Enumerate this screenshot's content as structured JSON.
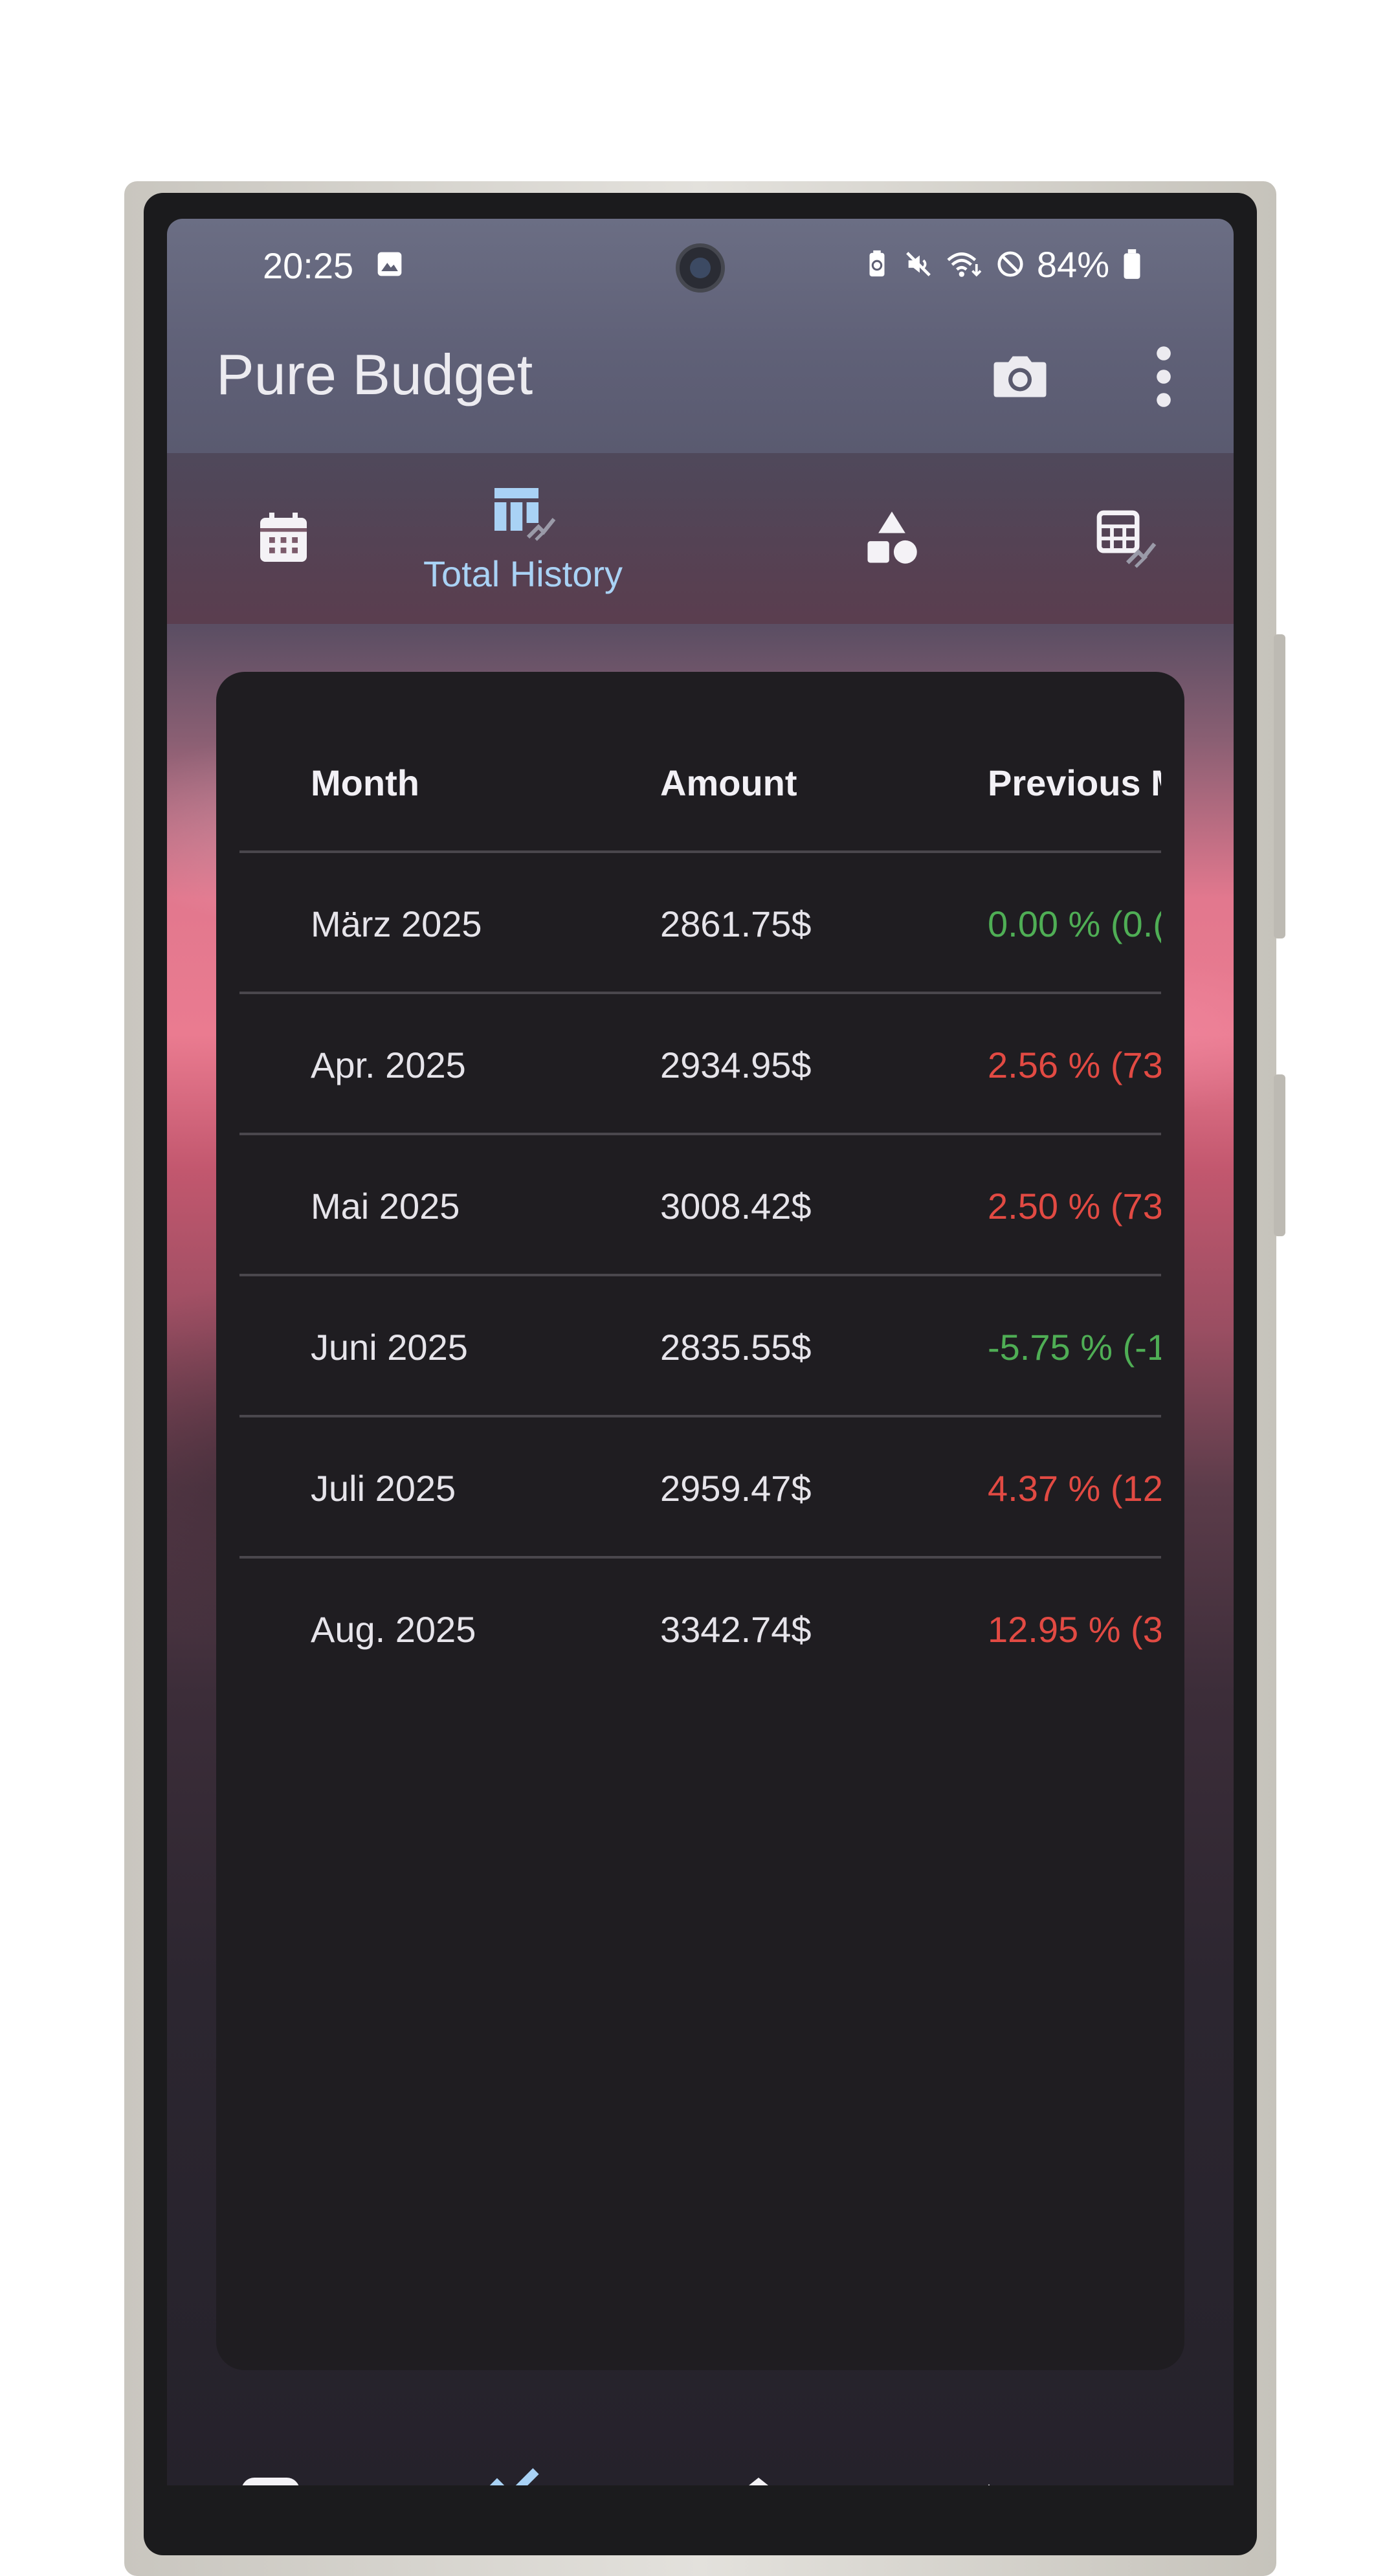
{
  "status_bar": {
    "time": "20:25",
    "battery_percent": "84%",
    "icons": [
      "image-icon",
      "battery-saver-icon",
      "mute-icon",
      "wifi-icon",
      "do-not-disturb-icon",
      "battery-icon"
    ]
  },
  "app_bar": {
    "title": "Pure Budget",
    "actions": [
      "camera-icon",
      "more-vert-icon"
    ]
  },
  "tabs": {
    "selected": "Total History",
    "items": [
      {
        "icon": "calendar-icon",
        "label": ""
      },
      {
        "icon": "table-chart-icon",
        "label": "Total History"
      },
      {
        "icon": "shapes-icon",
        "label": ""
      },
      {
        "icon": "table-chart-alt-icon",
        "label": ""
      }
    ]
  },
  "table": {
    "headers": {
      "month": "Month",
      "amount": "Amount",
      "previous": "Previous M"
    },
    "rows": [
      {
        "month": "März 2025",
        "amount": "2861.75$",
        "previous": "0.00 % (0.(",
        "trend": "positive"
      },
      {
        "month": "Apr. 2025",
        "amount": "2934.95$",
        "previous": "2.56 % (73",
        "trend": "negative"
      },
      {
        "month": "Mai 2025",
        "amount": "3008.42$",
        "previous": "2.50 % (73",
        "trend": "negative"
      },
      {
        "month": "Juni 2025",
        "amount": "2835.55$",
        "previous": "-5.75 % (-1",
        "trend": "positive"
      },
      {
        "month": "Juli 2025",
        "amount": "2959.47$",
        "previous": "4.37 % (12",
        "trend": "negative"
      },
      {
        "month": "Aug. 2025",
        "amount": "3342.74$",
        "previous": "12.95 % (3",
        "trend": "negative"
      }
    ]
  },
  "colors": {
    "positive": "#4fae55",
    "negative": "#e24a43",
    "accent": "#a9d2f5",
    "card": "#1f1d21"
  },
  "bottom_nav": {
    "items": [
      "receipt-icon",
      "trending-icon",
      "home-icon",
      "shapes-icon",
      "sync-icon"
    ]
  }
}
